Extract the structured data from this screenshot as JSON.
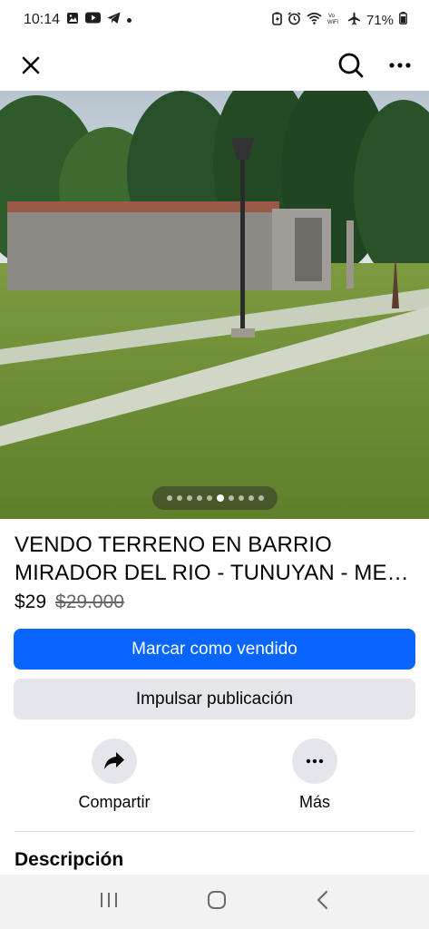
{
  "status_bar": {
    "time": "10:14",
    "battery": "71%",
    "left_icons": [
      "image-icon",
      "youtube-icon",
      "telegram-icon"
    ],
    "right_icons": [
      "battery-saver-icon",
      "alarm-icon",
      "wifi-icon",
      "vowifi-icon",
      "airplane-icon",
      "battery-icon"
    ],
    "vowifi_label": "Vo\nWiFi"
  },
  "app_bar": {
    "close_icon": "close-icon",
    "search_icon": "search-icon",
    "more_icon": "more-horizontal-icon"
  },
  "photo": {
    "image_count": 10,
    "active_index": 5
  },
  "listing": {
    "title_line1": "VENDO TERRENO EN BARRIO",
    "title_line2": "MIRADOR DEL RIO - TUNUYAN - MENDOZA",
    "price": "$29",
    "original_price": "$29.000"
  },
  "buttons": {
    "mark_sold": "Marcar como vendido",
    "boost": "Impulsar publicación"
  },
  "actions": {
    "share_label": "Compartir",
    "more_label": "Más"
  },
  "description": {
    "heading": "Descripción"
  },
  "colors": {
    "primary": "#0866ff",
    "secondary_bg": "#e4e6eb",
    "text": "#050505",
    "muted": "#65676b"
  }
}
